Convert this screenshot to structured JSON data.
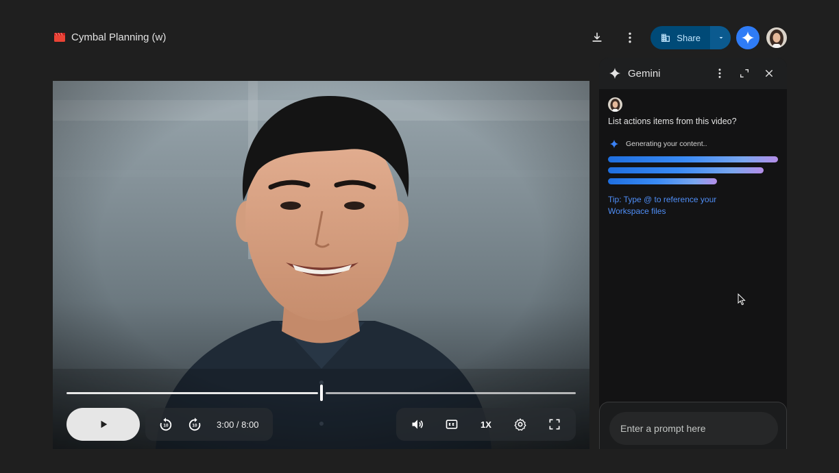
{
  "file": {
    "title": "Cymbal Planning (w)",
    "icon": "video-file-icon",
    "icon_color": "#ea4335"
  },
  "toolbar": {
    "download_icon": "download-icon",
    "more_icon": "more-vert-icon",
    "share_label": "Share",
    "share_icon": "domain-icon",
    "share_dropdown_icon": "arrow-drop-down-icon",
    "gemini_icon": "gemini-sparkle-icon",
    "accent": "#2f7cf6",
    "share_bg": "#004a77"
  },
  "player": {
    "progress_fraction": 0.5,
    "time_display": "3:00 / 8:00",
    "rewind_label": "10",
    "forward_label": "10",
    "speed_label": "1X",
    "controls": [
      "play-icon",
      "replay-10-icon",
      "forward-10-icon",
      "volume-icon",
      "closed-captions-icon",
      "settings-icon",
      "fullscreen-icon"
    ]
  },
  "gemini": {
    "title": "Gemini",
    "question": "List actions items from this video?",
    "status": "Generating your content..",
    "tip": "Tip: Type @ to reference your Workspace files",
    "prompt_placeholder": "Enter a prompt here",
    "loading_bars": [
      1.0,
      0.915,
      0.64
    ]
  }
}
